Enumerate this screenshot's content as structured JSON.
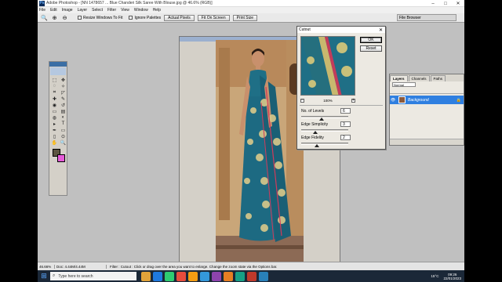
{
  "window": {
    "app_label": "Ps",
    "title": "Adobe Photoshop - [NN 1478657 ... Blue Chanderi Silk Saree With Blouse.jpg @ 46.6% (RGB)]"
  },
  "menu": [
    "File",
    "Edit",
    "Image",
    "Layer",
    "Select",
    "Filter",
    "View",
    "Window",
    "Help"
  ],
  "options_bar": {
    "zoom_tool_icon": "zoom-icon",
    "resize_windows_label": "Resize Windows To Fit",
    "ignore_palettes_label": "Ignore Palettes",
    "actual_pixels_label": "Actual Pixels",
    "fit_on_screen_label": "Fit On Screen",
    "print_size_label": "Print Size",
    "file_browser_label": "File Browser"
  },
  "toolbox": {
    "tools": [
      "marquee",
      "move",
      "lasso",
      "magic-wand",
      "crop",
      "slice",
      "healing",
      "brush",
      "stamp",
      "history-brush",
      "eraser",
      "gradient",
      "blur",
      "dodge",
      "path-select",
      "type",
      "pen",
      "shape",
      "notes",
      "eyedropper",
      "hand",
      "zoom"
    ],
    "glyphs": [
      "⬚",
      "✥",
      "◌",
      "✧",
      "⌗",
      "◸",
      "✚",
      "✎",
      "◉",
      "↺",
      "▭",
      "▤",
      "◍",
      "◐",
      "▸",
      "T",
      "✒",
      "▭",
      "▯",
      "⊙",
      "✋",
      "🔍"
    ],
    "foreground_color": "#5c5540",
    "background_color": "#e55bd8"
  },
  "dialog": {
    "title": "Cutout",
    "ok_label": "OK",
    "reset_label": "Reset",
    "zoom_value": "100%",
    "params": [
      {
        "label": "No. of Levels",
        "value": "6",
        "level": 0.43
      },
      {
        "label": "Edge Simplicity",
        "value": "3",
        "level": 0.3
      },
      {
        "label": "Edge Fidelity",
        "value": "2",
        "level": 0.33
      }
    ]
  },
  "layers_panel": {
    "tabs": [
      "Layers",
      "Channels",
      "Paths"
    ],
    "blend_mode": "Normal",
    "layer_name": "Background"
  },
  "statusbar": {
    "zoom": "46.66%",
    "doc_size": "Doc: 4.44M/4.44M",
    "hint": "Filter : Cutout : Click or drag over the area you want to enlarge. Change the zoom state via the Options bar."
  },
  "taskbar": {
    "search_placeholder": "Type here to search",
    "temperature": "15°C",
    "time": "09:26",
    "date": "22/01/2023",
    "colors": [
      "#e0a33a",
      "#1f7ae0",
      "#2ecc71",
      "#e74c3c",
      "#f39c12",
      "#3498db",
      "#8e44ad",
      "#e67e22",
      "#16a085",
      "#c0392b",
      "#2980b9"
    ]
  }
}
